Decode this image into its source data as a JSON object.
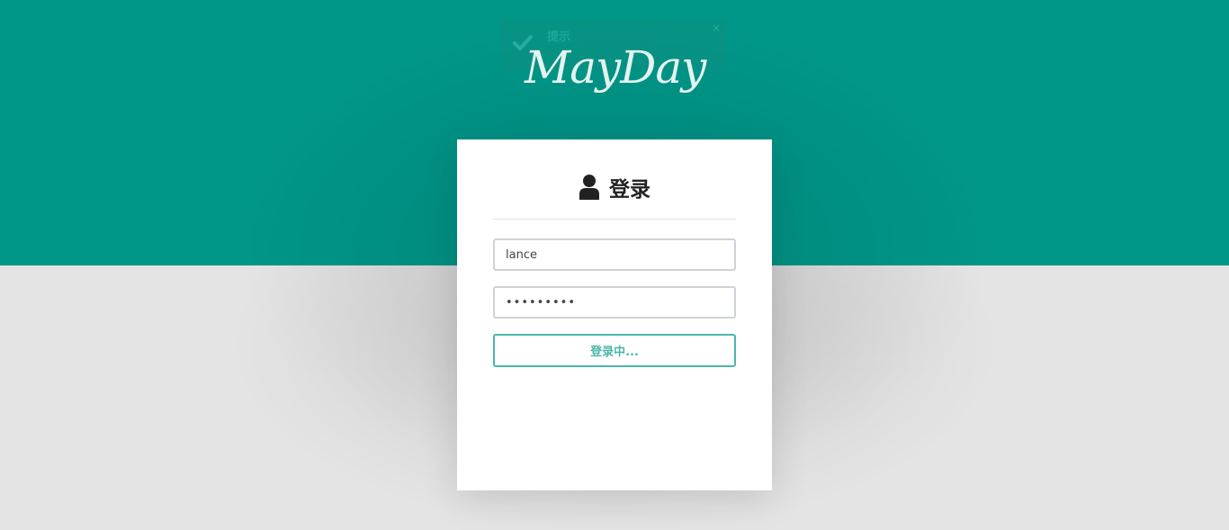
{
  "toast": {
    "title": "提示",
    "close_glyph": "×",
    "icon": "check-icon"
  },
  "logo": {
    "text": "MayDay"
  },
  "login_card": {
    "icon": "user-icon",
    "title": "登录",
    "username": {
      "value": "lance"
    },
    "password": {
      "masked_value": "•••••••••"
    },
    "submit_label": "登录中..."
  },
  "colors": {
    "primary": "#009688",
    "background": "#e4e4e4",
    "button_accent": "#4ab7a8",
    "card": "#ffffff"
  }
}
